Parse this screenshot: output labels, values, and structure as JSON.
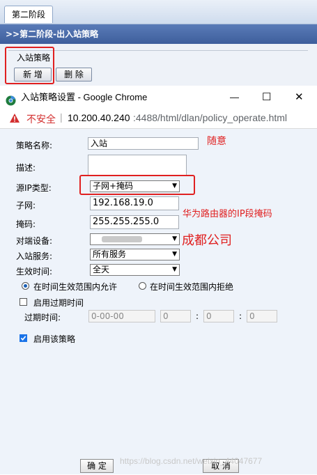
{
  "app": {
    "tab_label": "第二阶段",
    "section_title": ">>第二阶段-出入站策略",
    "legend": "入站策略",
    "add_button": "新 增",
    "delete_button": "删 除"
  },
  "window": {
    "title": "入站策略设置 - Google Chrome",
    "minimize": "—",
    "maximize": "☐",
    "close": "✕",
    "insecure_label": "不安全",
    "url_host": "10.200.40.240",
    "url_rest": ":4488/html/dlan/policy_operate.html"
  },
  "form": {
    "name_label": "策略名称:",
    "name_value": "入站",
    "desc_label": "描述:",
    "desc_value": "",
    "src_type_label": "源IP类型:",
    "src_type_value": "子网+掩码",
    "subnet_label": "子网:",
    "subnet_value": "192.168.19.0",
    "mask_label": "掩码:",
    "mask_value": "255.255.255.0",
    "peer_label": "对端设备:",
    "peer_value": "",
    "service_label": "入站服务:",
    "service_value": "所有服务",
    "time_label": "生效时间:",
    "time_value": "全天",
    "radio_allow": "在时间生效范围内允许",
    "radio_deny": "在时间生效范围内拒绝",
    "expire_check_label": "启用过期时间",
    "expire_label": "过期时间:",
    "expire_date": "0-00-00",
    "expire_h": "0",
    "expire_m": "0",
    "expire_s": "0",
    "colon": ":",
    "enable_label": "启用该策略"
  },
  "annotations": {
    "name_note": "随意",
    "subnet_note": "华为路由器的IP段掩码",
    "peer_note": "成都公司"
  },
  "footer": {
    "ok": "确 定",
    "cancel": "取 消",
    "watermark": "https://blog.csdn.net/weixin_44047677"
  },
  "colors": {
    "annotation_red": "#e02020",
    "header_blue": "#3d5e9c",
    "content_bg": "#eef3fa"
  }
}
